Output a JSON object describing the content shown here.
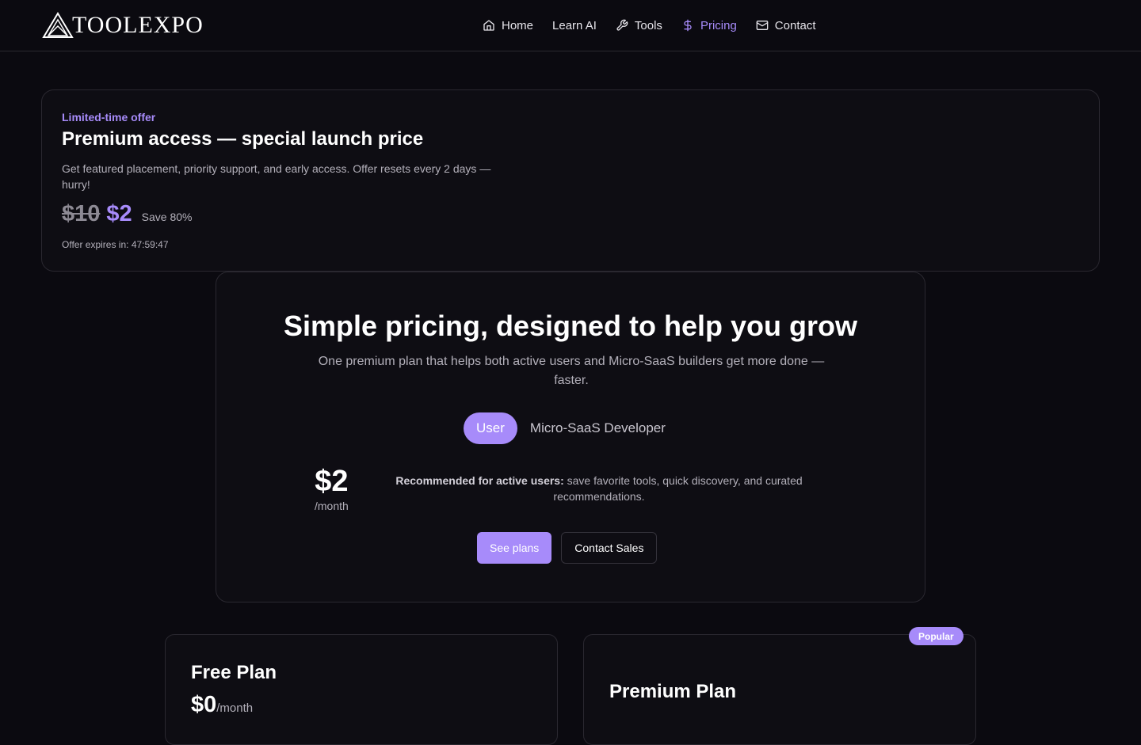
{
  "brand": {
    "name": "TOOLEXPO"
  },
  "nav": {
    "items": [
      {
        "label": "Home",
        "icon": "home-icon"
      },
      {
        "label": "Learn AI",
        "icon": ""
      },
      {
        "label": "Tools",
        "icon": "wrench-icon"
      },
      {
        "label": "Pricing",
        "icon": "dollar-icon",
        "active": true
      },
      {
        "label": "Contact",
        "icon": "mail-icon"
      }
    ]
  },
  "offer": {
    "tag": "Limited-time offer",
    "title": "Premium access — special launch price",
    "description": "Get featured placement, priority support, and early access. Offer resets every 2 days — hurry!",
    "old_price": "$10",
    "new_price": "$2",
    "save": "Save 80%",
    "expiry": "Offer expires in: 47:59:47"
  },
  "pricing": {
    "title": "Simple pricing, designed to help you grow",
    "subtitle": "One premium plan that helps both active users and Micro-SaaS builders get more done — faster.",
    "toggle": {
      "user": "User",
      "developer": "Micro-SaaS Developer",
      "selected": "User"
    },
    "price": "$2",
    "period": "/month",
    "recommend_label": "Recommended for active users:",
    "recommend_text": " save favorite tools, quick discovery, and curated recommendations.",
    "see_plans": "See plans",
    "contact_sales": "Contact Sales"
  },
  "plans": {
    "free": {
      "name": "Free Plan",
      "price": "$0",
      "period": "/month"
    },
    "premium": {
      "name": "Premium Plan",
      "badge": "Popular"
    }
  },
  "colors": {
    "accent": "#a78bfa",
    "background": "#0b0a10",
    "card": "#0e0d13",
    "border": "#2a2830"
  }
}
